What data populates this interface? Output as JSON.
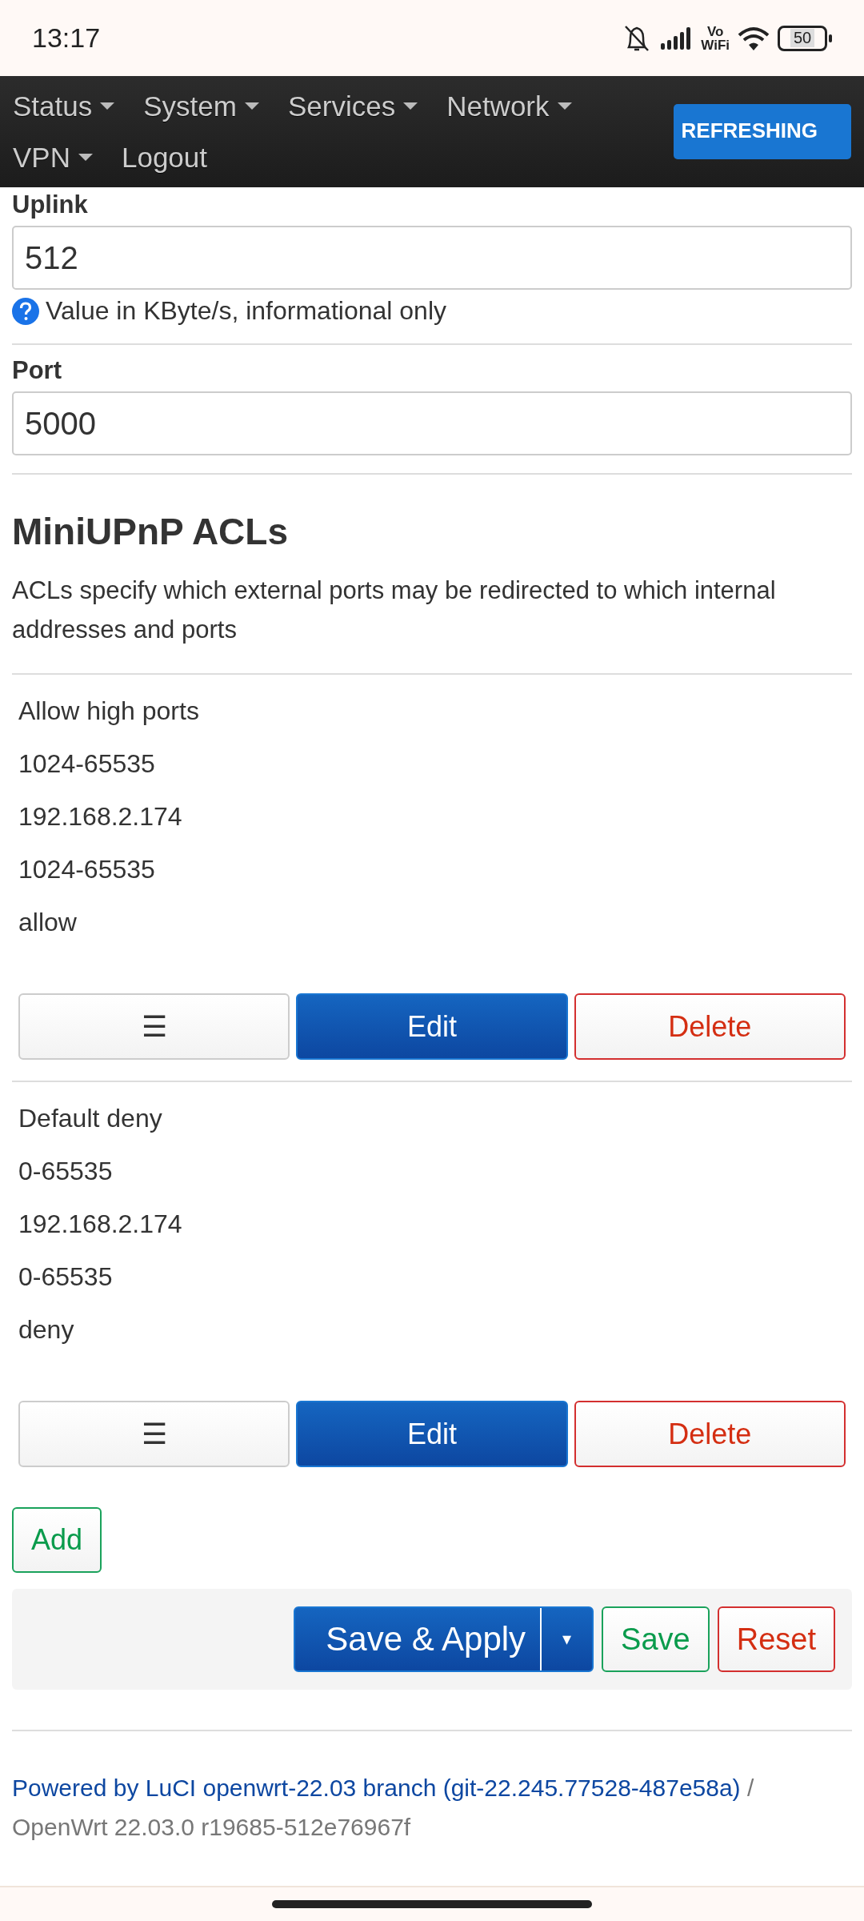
{
  "status_bar": {
    "time": "13:17",
    "vowifi": [
      "Vo",
      "WiFi"
    ],
    "battery": "50"
  },
  "nav": {
    "items": [
      {
        "label": "Status",
        "dropdown": true
      },
      {
        "label": "System",
        "dropdown": true
      },
      {
        "label": "Services",
        "dropdown": true
      },
      {
        "label": "Network",
        "dropdown": true
      },
      {
        "label": "VPN",
        "dropdown": true
      },
      {
        "label": "Logout",
        "dropdown": false
      }
    ],
    "indicator": "REFRESHING"
  },
  "fields": [
    {
      "label": "Uplink",
      "value": "512",
      "help": "Value in KByte/s, informational only"
    },
    {
      "label": "Port",
      "value": "5000"
    }
  ],
  "section": {
    "title": "MiniUPnP ACLs",
    "description": "ACLs specify which external ports may be redirected to which internal addresses and ports",
    "rows": [
      {
        "cells": [
          "Allow high ports",
          "1024-65535",
          "192.168.2.174",
          "1024-65535",
          "allow"
        ],
        "buttons": [
          {
            "kind": "neutral",
            "label": "☰"
          },
          {
            "kind": "primary",
            "label": "Edit"
          },
          {
            "kind": "negative",
            "label": "Delete"
          }
        ]
      },
      {
        "cells": [
          "Default deny",
          "0-65535",
          "192.168.2.174",
          "0-65535",
          "deny"
        ],
        "buttons": [
          {
            "kind": "neutral",
            "label": "☰"
          },
          {
            "kind": "primary",
            "label": "Edit"
          },
          {
            "kind": "negative",
            "label": "Delete"
          }
        ]
      }
    ],
    "add_button": "Add"
  },
  "actions": {
    "save_apply": "Save & Apply",
    "dropdown": "▾",
    "save": "Save",
    "reset": "Reset"
  },
  "footer": {
    "link": "Powered by LuCI openwrt-22.03 branch (git-22.245.77528-487e58a)",
    "separator": "/",
    "version": "OpenWrt 22.03.0 r19685-512e76967f"
  }
}
